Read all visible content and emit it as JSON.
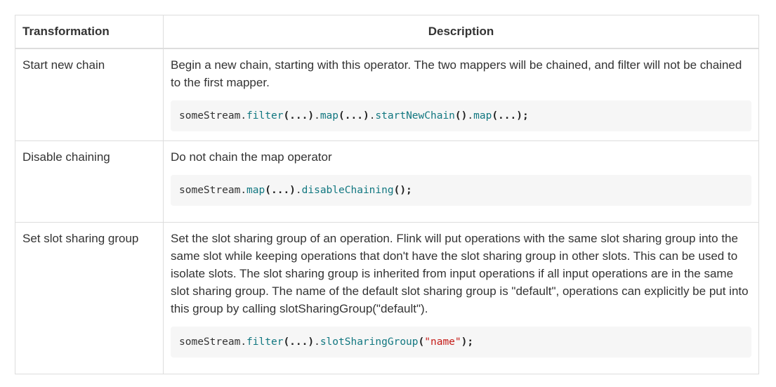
{
  "table": {
    "headers": {
      "transformation": "Transformation",
      "description": "Description"
    },
    "rows": [
      {
        "name": "Start new chain",
        "description": "Begin a new chain, starting with this operator. The two mappers will be chained, and filter will not be chained to the first mapper.",
        "code": [
          {
            "t": "someStream",
            "k": "plain"
          },
          {
            "t": ".",
            "k": "plain"
          },
          {
            "t": "filter",
            "k": "fn"
          },
          {
            "t": "(...)",
            "k": "punct"
          },
          {
            "t": ".",
            "k": "plain"
          },
          {
            "t": "map",
            "k": "fn"
          },
          {
            "t": "(...)",
            "k": "punct"
          },
          {
            "t": ".",
            "k": "plain"
          },
          {
            "t": "startNewChain",
            "k": "fn"
          },
          {
            "t": "()",
            "k": "punct"
          },
          {
            "t": ".",
            "k": "plain"
          },
          {
            "t": "map",
            "k": "fn"
          },
          {
            "t": "(...);",
            "k": "punct"
          }
        ]
      },
      {
        "name": "Disable chaining",
        "description": "Do not chain the map operator",
        "code": [
          {
            "t": "someStream",
            "k": "plain"
          },
          {
            "t": ".",
            "k": "plain"
          },
          {
            "t": "map",
            "k": "fn"
          },
          {
            "t": "(...)",
            "k": "punct"
          },
          {
            "t": ".",
            "k": "plain"
          },
          {
            "t": "disableChaining",
            "k": "fn"
          },
          {
            "t": "();",
            "k": "punct"
          }
        ]
      },
      {
        "name": "Set slot sharing group",
        "description": "Set the slot sharing group of an operation. Flink will put operations with the same slot sharing group into the same slot while keeping operations that don't have the slot sharing group in other slots. This can be used to isolate slots. The slot sharing group is inherited from input operations if all input operations are in the same slot sharing group. The name of the default slot sharing group is \"default\", operations can explicitly be put into this group by calling slotSharingGroup(\"default\").",
        "code": [
          {
            "t": "someStream",
            "k": "plain"
          },
          {
            "t": ".",
            "k": "plain"
          },
          {
            "t": "filter",
            "k": "fn"
          },
          {
            "t": "(...)",
            "k": "punct"
          },
          {
            "t": ".",
            "k": "plain"
          },
          {
            "t": "slotSharingGroup",
            "k": "fn"
          },
          {
            "t": "(",
            "k": "punct"
          },
          {
            "t": "\"name\"",
            "k": "str"
          },
          {
            "t": ");",
            "k": "punct"
          }
        ]
      }
    ]
  },
  "colors": {
    "border": "#dddddd",
    "code_bg": "#f6f6f6",
    "code_function": "#117780",
    "code_string": "#c41a16",
    "text": "#333333"
  }
}
